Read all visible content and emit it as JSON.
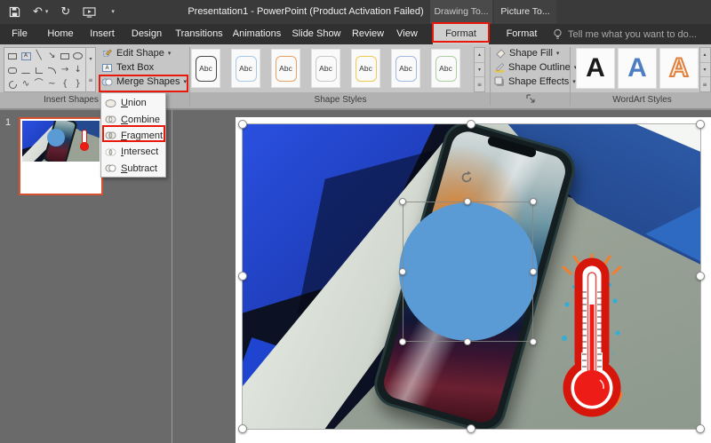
{
  "titlebar": {
    "title": "Presentation1 - PowerPoint (Product Activation Failed)",
    "drawing_tools_label": "Drawing To...",
    "picture_tools_label": "Picture To..."
  },
  "menubar": {
    "tabs": [
      "File",
      "Home",
      "Insert",
      "Design",
      "Transitions",
      "Animations",
      "Slide Show",
      "Review",
      "View"
    ],
    "format_drawing_label": "Format",
    "format_picture_label": "Format",
    "tell_me": "Tell me what you want to do..."
  },
  "ribbon": {
    "groups": {
      "insert_shapes": "Insert Shapes",
      "shape_styles": "Shape Styles",
      "wordart_styles": "WordArt Styles"
    },
    "buttons": {
      "edit_shape": "Edit Shape",
      "text_box": "Text Box",
      "merge_shapes": "Merge Shapes",
      "shape_fill": "Shape Fill",
      "shape_outline": "Shape Outline",
      "shape_effects": "Shape Effects"
    },
    "merge_menu": {
      "items": [
        {
          "first": "U",
          "rest": "nion"
        },
        {
          "first": "C",
          "rest": "ombine"
        },
        {
          "first": "F",
          "rest": "ragment"
        },
        {
          "first": "I",
          "rest": "ntersect"
        },
        {
          "first": "S",
          "rest": "ubtract"
        }
      ]
    },
    "shape_style_tiles": [
      {
        "label": "Abc",
        "border": "#4a4a4a"
      },
      {
        "label": "Abc",
        "border": "#a9c8e8"
      },
      {
        "label": "Abc",
        "border": "#e9a266"
      },
      {
        "label": "Abc",
        "border": "#c9c9c9"
      },
      {
        "label": "Abc",
        "border": "#eecb4d"
      },
      {
        "label": "Abc",
        "border": "#a2b9e2"
      },
      {
        "label": "Abc",
        "border": "#abd0a0"
      }
    ],
    "wordart_tiles": [
      {
        "letter": "A",
        "style": "black"
      },
      {
        "letter": "A",
        "style": "blue"
      },
      {
        "letter": "A",
        "style": "orange-outline"
      }
    ]
  },
  "glyphs": {
    "caret": "▾",
    "up_arrow": "▴",
    "more": "≡",
    "diag_line": "╲",
    "diag_arrow": "↘",
    "right_arrow": "→",
    "down_arrow": "↓",
    "scribble": "∿",
    "arc": "⌒",
    "wave": "~",
    "brace_left": "{",
    "brace_right": "}",
    "icon_letter_a": "A",
    "undo": "↶",
    "redo": "↻"
  },
  "slides_panel": {
    "slide_number": "1"
  },
  "colors": {
    "annotation_red": "#e8190b",
    "accent_circle_blue": "#5b9bd5",
    "thumbnail_selected_border": "#d9502f",
    "titlebar_bg": "#3a3a3a",
    "ribbon_bg": "#c6c6c6",
    "canvas_bg": "#6a6a6a",
    "slide_bg": "#ffffff",
    "thermometer_red": "#d6150b",
    "wordart_blue": "#4d7ec2",
    "wordart_orange": "#e0803c"
  }
}
